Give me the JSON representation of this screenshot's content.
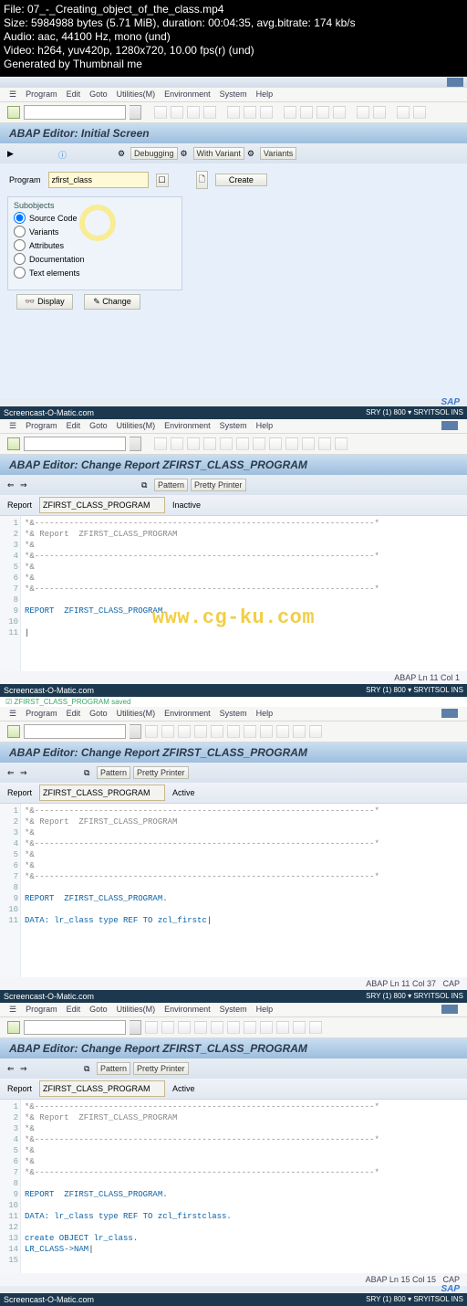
{
  "header": {
    "file": "File: 07_-_Creating_object_of_the_class.mp4",
    "size": "Size: 5984988 bytes (5.71 MiB), duration: 00:04:35, avg.bitrate: 174 kb/s",
    "audio": "Audio: aac, 44100 Hz, mono (und)",
    "video": "Video: h264, yuv420p, 1280x720, 10.00 fps(r) (und)",
    "generated": "Generated by Thumbnail me"
  },
  "menu": {
    "items": [
      "Program",
      "Edit",
      "Goto",
      "Utilities(M)",
      "Environment",
      "System",
      "Help"
    ]
  },
  "panel1": {
    "title": "ABAP Editor: Initial Screen",
    "tb_items": [
      "Debugging",
      "With Variant",
      "Variants"
    ],
    "prog_label": "Program",
    "prog_value": "zfirst_class",
    "create": "Create",
    "sub_title": "Subobjects",
    "radios": [
      "Source Code",
      "Variants",
      "Attributes",
      "Documentation",
      "Text elements"
    ],
    "display": "Display",
    "change": "Change"
  },
  "som": "Screencast-O-Matic.com",
  "panel2": {
    "title": "ABAP Editor: Change Report ZFIRST_CLASS_PROGRAM",
    "pattern": "Pattern",
    "pretty": "Pretty Printer",
    "report_label": "Report",
    "report_value": "ZFIRST_CLASS_PROGRAM",
    "status_inactive": "Inactive",
    "status_active": "Active",
    "code_c1": "*&---------------------------------------------------------------------*",
    "code_c2": "*& Report  ZFIRST_CLASS_PROGRAM",
    "code_c3": "*&",
    "code_c4": "*&---------------------------------------------------------------------*",
    "code_c5": "*&",
    "code_c6": "*&",
    "code_c7": "*&---------------------------------------------------------------------*",
    "code_report": "REPORT  ZFIRST_CLASS_PROGRAM.",
    "status_text": "ABAP    Ln 11 Col  1"
  },
  "mid_msg": "ZFIRST_CLASS_PROGRAM saved",
  "panel3": {
    "code_data": "DATA: lr_class type REF TO zcl_firstc",
    "status_text": "ABAP    Ln 11 Col 37",
    "cap": "CAP"
  },
  "sys": "SRY (1) 800 ▾   SRYITSOL   INS",
  "panel4": {
    "code_data": "DATA: lr_class type REF TO zcl_firstclass.",
    "code_create": "create OBJECT lr_class.",
    "code_lr": "LR_CLASS->NAM",
    "status_text": "ABAP    Ln 15 Col 15",
    "cap": "CAP"
  },
  "watermark": "www.cg-ku.com"
}
